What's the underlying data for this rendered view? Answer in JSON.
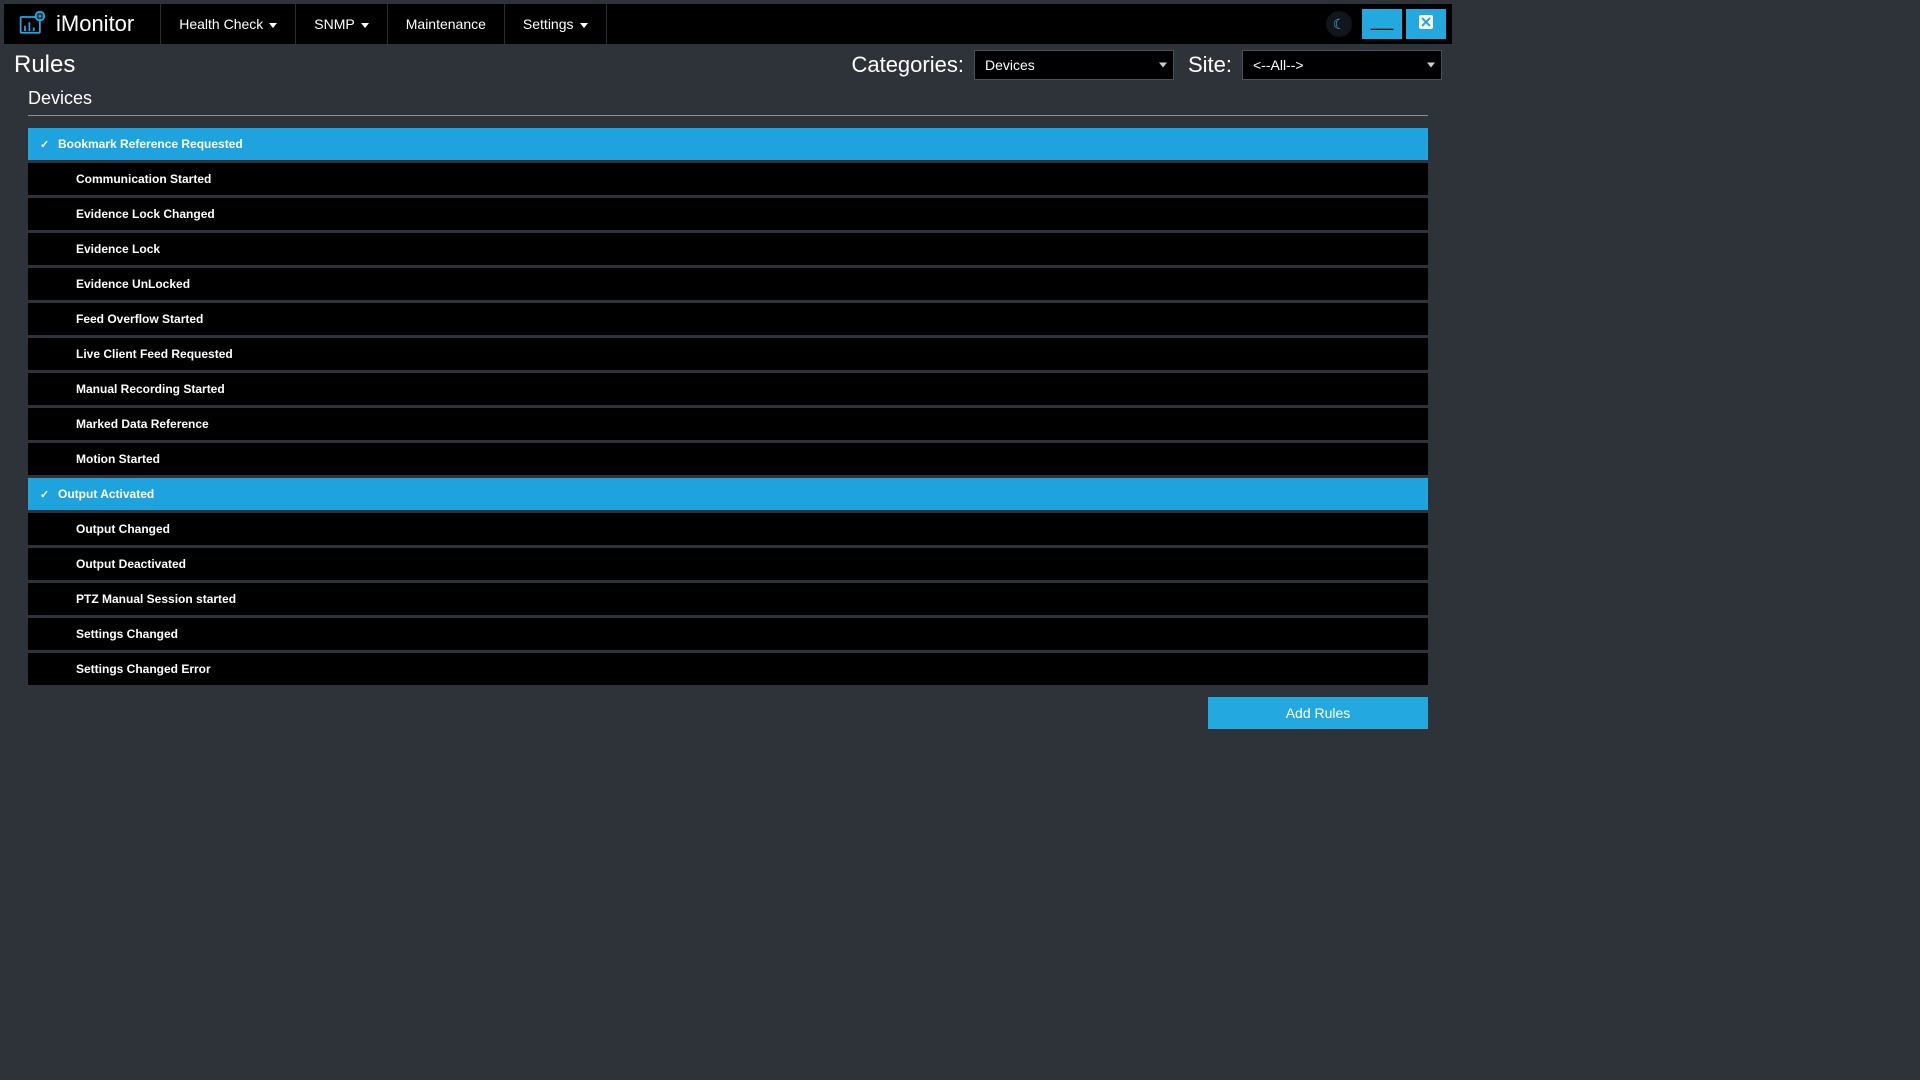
{
  "app": {
    "name": "iMonitor"
  },
  "nav": {
    "items": [
      {
        "label": "Health Check",
        "has_caret": true
      },
      {
        "label": "SNMP",
        "has_caret": true
      },
      {
        "label": "Maintenance",
        "has_caret": false
      },
      {
        "label": "Settings",
        "has_caret": true
      }
    ]
  },
  "page": {
    "title": "Rules"
  },
  "filters": {
    "categories_label": "Categories:",
    "categories_value": "Devices",
    "site_label": "Site:",
    "site_value": "<--All-->"
  },
  "section": {
    "title": "Devices"
  },
  "rules": [
    {
      "label": "Bookmark Reference Requested",
      "selected": true
    },
    {
      "label": "Communication Started",
      "selected": false
    },
    {
      "label": "Evidence Lock Changed",
      "selected": false
    },
    {
      "label": "Evidence Lock",
      "selected": false
    },
    {
      "label": "Evidence UnLocked",
      "selected": false
    },
    {
      "label": "Feed Overflow Started",
      "selected": false
    },
    {
      "label": "Live Client Feed Requested",
      "selected": false
    },
    {
      "label": "Manual Recording Started",
      "selected": false
    },
    {
      "label": "Marked Data Reference",
      "selected": false
    },
    {
      "label": "Motion Started",
      "selected": false
    },
    {
      "label": "Output Activated",
      "selected": true
    },
    {
      "label": "Output Changed",
      "selected": false
    },
    {
      "label": "Output Deactivated",
      "selected": false
    },
    {
      "label": "PTZ Manual Session started",
      "selected": false
    },
    {
      "label": "Settings Changed",
      "selected": false
    },
    {
      "label": "Settings Changed Error",
      "selected": false
    }
  ],
  "buttons": {
    "add_rules": "Add Rules"
  },
  "colors": {
    "accent": "#24a8e0",
    "bg": "#2d3339",
    "panel": "#000000"
  }
}
